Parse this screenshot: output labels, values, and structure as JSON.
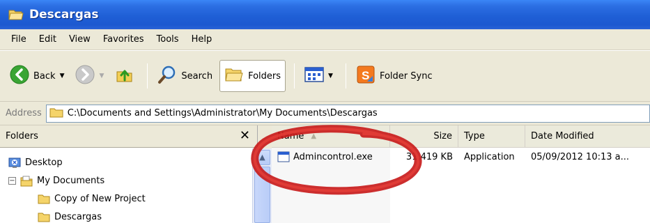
{
  "window": {
    "title": "Descargas"
  },
  "menu": [
    "File",
    "Edit",
    "View",
    "Favorites",
    "Tools",
    "Help"
  ],
  "toolbar": {
    "back_label": "Back",
    "search_label": "Search",
    "folders_label": "Folders",
    "foldersync_label": "Folder Sync"
  },
  "address": {
    "label": "Address",
    "path": "C:\\Documents and Settings\\Administrator\\My Documents\\Descargas"
  },
  "folders": {
    "header": "Folders",
    "close_glyph": "✕",
    "items": [
      {
        "label": "Desktop",
        "icon": "desktop-icon"
      },
      {
        "label": "My Documents",
        "icon": "my-documents-icon",
        "expander": "−"
      },
      {
        "label": "Copy of New Project",
        "icon": "folder-icon"
      },
      {
        "label": "Descargas",
        "icon": "folder-icon"
      }
    ]
  },
  "filelist": {
    "columns": {
      "name": "Name",
      "size": "Size",
      "type": "Type",
      "date": "Date Modified"
    },
    "rows": [
      {
        "name": "Admincontrol.exe",
        "size": "31,419 KB",
        "type": "Application",
        "date": "05/09/2012 10:13 a..."
      }
    ]
  },
  "colors": {
    "titlebar": "#2c6fe3",
    "annotation": "#d81e1e"
  }
}
